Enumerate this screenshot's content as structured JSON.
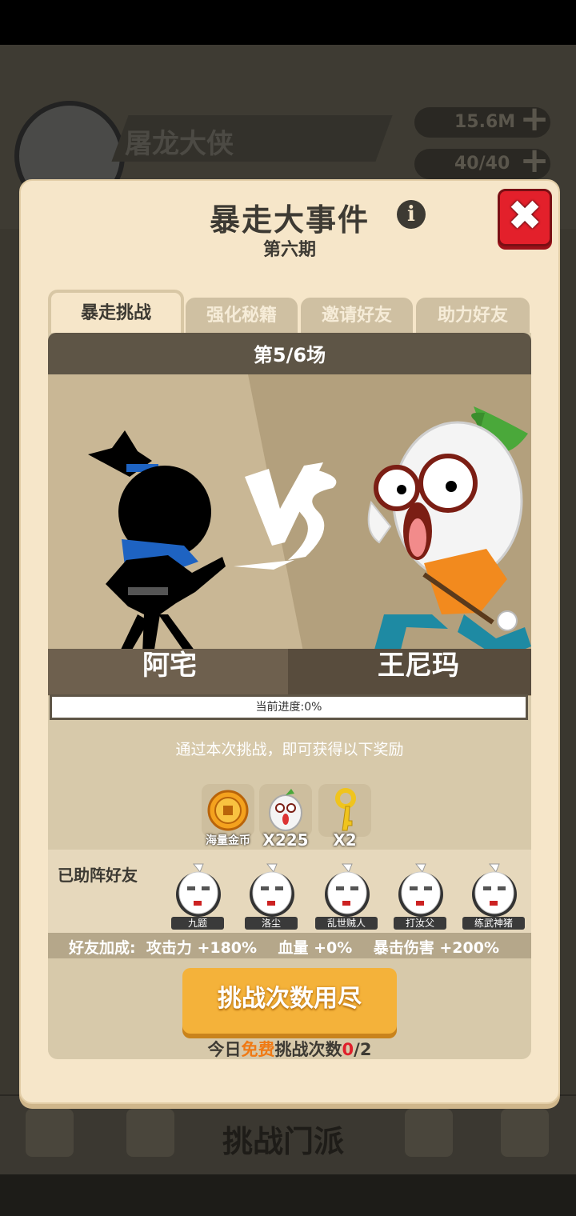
{
  "background": {
    "player_name": "屠龙大侠",
    "gold": "15.6M",
    "energy": "40/40",
    "bottom_nav_label": "挑战门派"
  },
  "dialog": {
    "title": "暴走大事件",
    "subtitle": "第六期",
    "tabs": [
      {
        "label": "暴走挑战",
        "active": true
      },
      {
        "label": "强化秘籍",
        "active": false
      },
      {
        "label": "邀请好友",
        "active": false
      },
      {
        "label": "助力好友",
        "active": false
      }
    ],
    "round": "第5/6场",
    "fighter_left": "阿宅",
    "fighter_right": "王尼玛",
    "progress_label": "当前进度:0%",
    "progress_value": 0,
    "reward_tip": "通过本次挑战，即可获得以下奖励",
    "rewards": [
      {
        "icon": "gold-coin-icon",
        "label": "海量金币"
      },
      {
        "icon": "wangnima-head-icon",
        "label": "X225"
      },
      {
        "icon": "key-icon",
        "label": "X2"
      }
    ],
    "friends_label": "已助阵好友",
    "friends": [
      "九题",
      "洛尘",
      "乱世贼人",
      "打汝父",
      "练武神猪"
    ],
    "bonus": "好友加成:  攻击力 +180%    血量 +0%    暴击伤害 +200%",
    "challenge_button": "挑战次数用尽",
    "daily_prefix": "今日",
    "daily_free": "免费",
    "daily_mid": "挑战次数",
    "daily_used": "0",
    "daily_total": "/2"
  },
  "colors": {
    "accent_orange": "#f4b23a",
    "close_red": "#e3202b",
    "dialog_bg": "#f6e6c9"
  }
}
